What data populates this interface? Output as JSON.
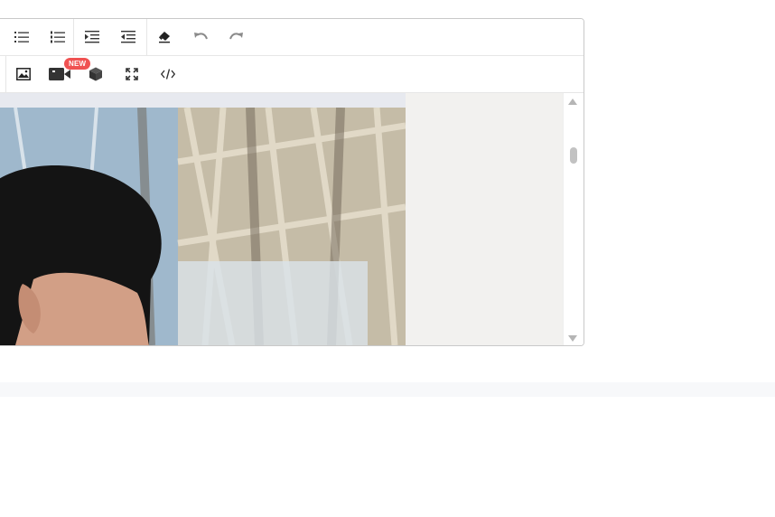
{
  "toolbar": {
    "row1": [
      {
        "name": "bulleted-list-button",
        "icon": "bulleted-list-icon"
      },
      {
        "name": "numbered-list-button",
        "icon": "numbered-list-icon"
      },
      {
        "name": "indent-button",
        "icon": "indent-icon"
      },
      {
        "name": "outdent-button",
        "icon": "outdent-icon"
      },
      {
        "name": "clear-format-button",
        "icon": "eraser-icon"
      },
      {
        "name": "undo-button",
        "icon": "undo-icon"
      },
      {
        "name": "redo-button",
        "icon": "redo-icon"
      }
    ],
    "row2": [
      {
        "name": "insert-image-button",
        "icon": "image-icon"
      },
      {
        "name": "insert-video-button",
        "icon": "video-icon"
      },
      {
        "name": "insert-3d-model-button",
        "icon": "cube-icon"
      },
      {
        "name": "fullscreen-button",
        "icon": "fullscreen-icon"
      },
      {
        "name": "source-code-button",
        "icon": "code-icon"
      }
    ],
    "video_badge": "NEW"
  },
  "colors": {
    "border": "#c9c9c9",
    "icon": "#333333",
    "icon_disabled": "#8a8a8a",
    "badge_bg": "#f05252",
    "content_bg": "#f2f1ef"
  }
}
